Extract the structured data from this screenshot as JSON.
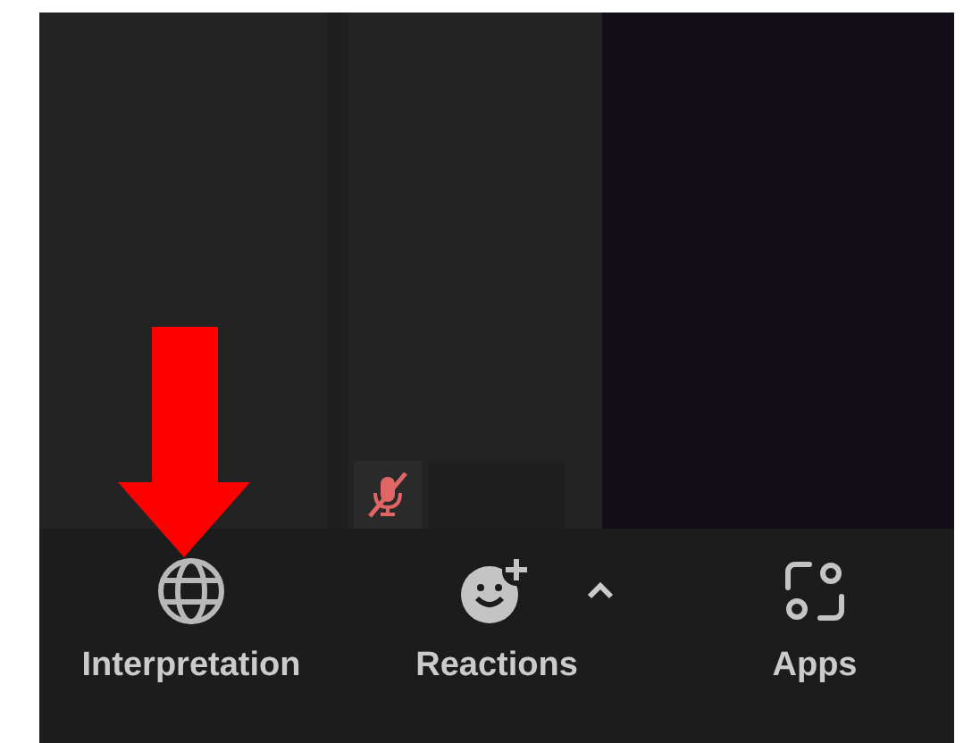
{
  "tiles": [
    {
      "kind": "empty"
    },
    {
      "kind": "participant",
      "muted": true
    },
    {
      "kind": "video"
    }
  ],
  "toolbar": {
    "buttons": [
      {
        "kind": "interpretation",
        "label": "Interpretation",
        "has_menu": false
      },
      {
        "kind": "reactions",
        "label": "Reactions",
        "has_menu": true
      },
      {
        "kind": "apps",
        "label": "Apps",
        "has_menu": false
      }
    ]
  },
  "annotation": {
    "kind": "arrow"
  }
}
